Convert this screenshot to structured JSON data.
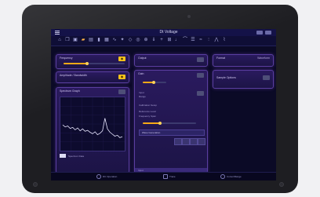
{
  "app": {
    "title": "Dt Voltage",
    "appbar_buttons": [
      "maximize",
      "close"
    ]
  },
  "toolbar": {
    "icons": [
      {
        "name": "home-icon",
        "glyph": "⌂"
      },
      {
        "name": "copy-icon",
        "glyph": "❐"
      },
      {
        "name": "save-icon",
        "glyph": "▣"
      },
      {
        "name": "folder-icon",
        "glyph": "▰",
        "highlight": true
      },
      {
        "name": "file-icon",
        "glyph": "▤"
      },
      {
        "name": "bar-icon",
        "glyph": "▮"
      },
      {
        "name": "keyboard-icon",
        "glyph": "▦"
      },
      {
        "name": "signal-icon",
        "glyph": "∿"
      },
      {
        "name": "spark-icon",
        "glyph": "✦"
      },
      {
        "name": "filter-icon",
        "glyph": "◇"
      },
      {
        "name": "target-icon",
        "glyph": "◎"
      },
      {
        "name": "compass-icon",
        "glyph": "⊕"
      },
      {
        "name": "down-icon",
        "glyph": "⇓"
      },
      {
        "name": "plus-icon",
        "glyph": "+"
      },
      {
        "name": "grid-icon",
        "glyph": "⊞"
      },
      {
        "name": "tuning-icon",
        "glyph": "♩"
      },
      {
        "name": "curve-icon",
        "glyph": "⌒"
      },
      {
        "name": "list-icon",
        "glyph": "☰"
      },
      {
        "name": "wave-icon",
        "glyph": "≈"
      },
      {
        "name": "bars-icon",
        "glyph": "⫶"
      },
      {
        "name": "peak-icon",
        "glyph": "⋀"
      },
      {
        "name": "chart-icon",
        "glyph": "⌇"
      }
    ]
  },
  "left": {
    "panel1": {
      "title": "Frequency"
    },
    "panel2": {
      "title": "Amplitude / Bandwidth"
    },
    "panel3": {
      "title": "Spectrum Graph",
      "legend": "Spectrum Data"
    }
  },
  "middle": {
    "panel1": {
      "title": "Output"
    },
    "panel2": {
      "title": "Gain",
      "labels": [
        "Input",
        "Range",
        "Calibration Setup",
        "Reference Level",
        "Frequency Span"
      ],
      "combo": "Wave Generation",
      "footer": "Input"
    }
  },
  "right": {
    "panel1": {
      "title": "Format",
      "right": "Waveform"
    },
    "panel2": {
      "title": "Sample Options"
    }
  },
  "bottom": {
    "items": [
      {
        "label": "DC Operation",
        "icon": "power-icon"
      },
      {
        "label": "Trace",
        "icon": "trace-icon"
      },
      {
        "label": "Cursor/Range",
        "icon": "cursor-icon"
      }
    ]
  },
  "chart_data": {
    "type": "line",
    "series": [
      {
        "values": [
          0.48,
          0.44,
          0.46,
          0.41,
          0.43,
          0.38,
          0.42,
          0.36,
          0.4,
          0.35,
          0.37,
          0.33,
          0.3,
          0.34,
          0.28,
          0.31,
          0.36,
          0.62,
          0.4,
          0.33,
          0.29,
          0.25,
          0.27,
          0.22,
          0.24
        ]
      }
    ],
    "ylim": [
      0,
      1
    ]
  }
}
